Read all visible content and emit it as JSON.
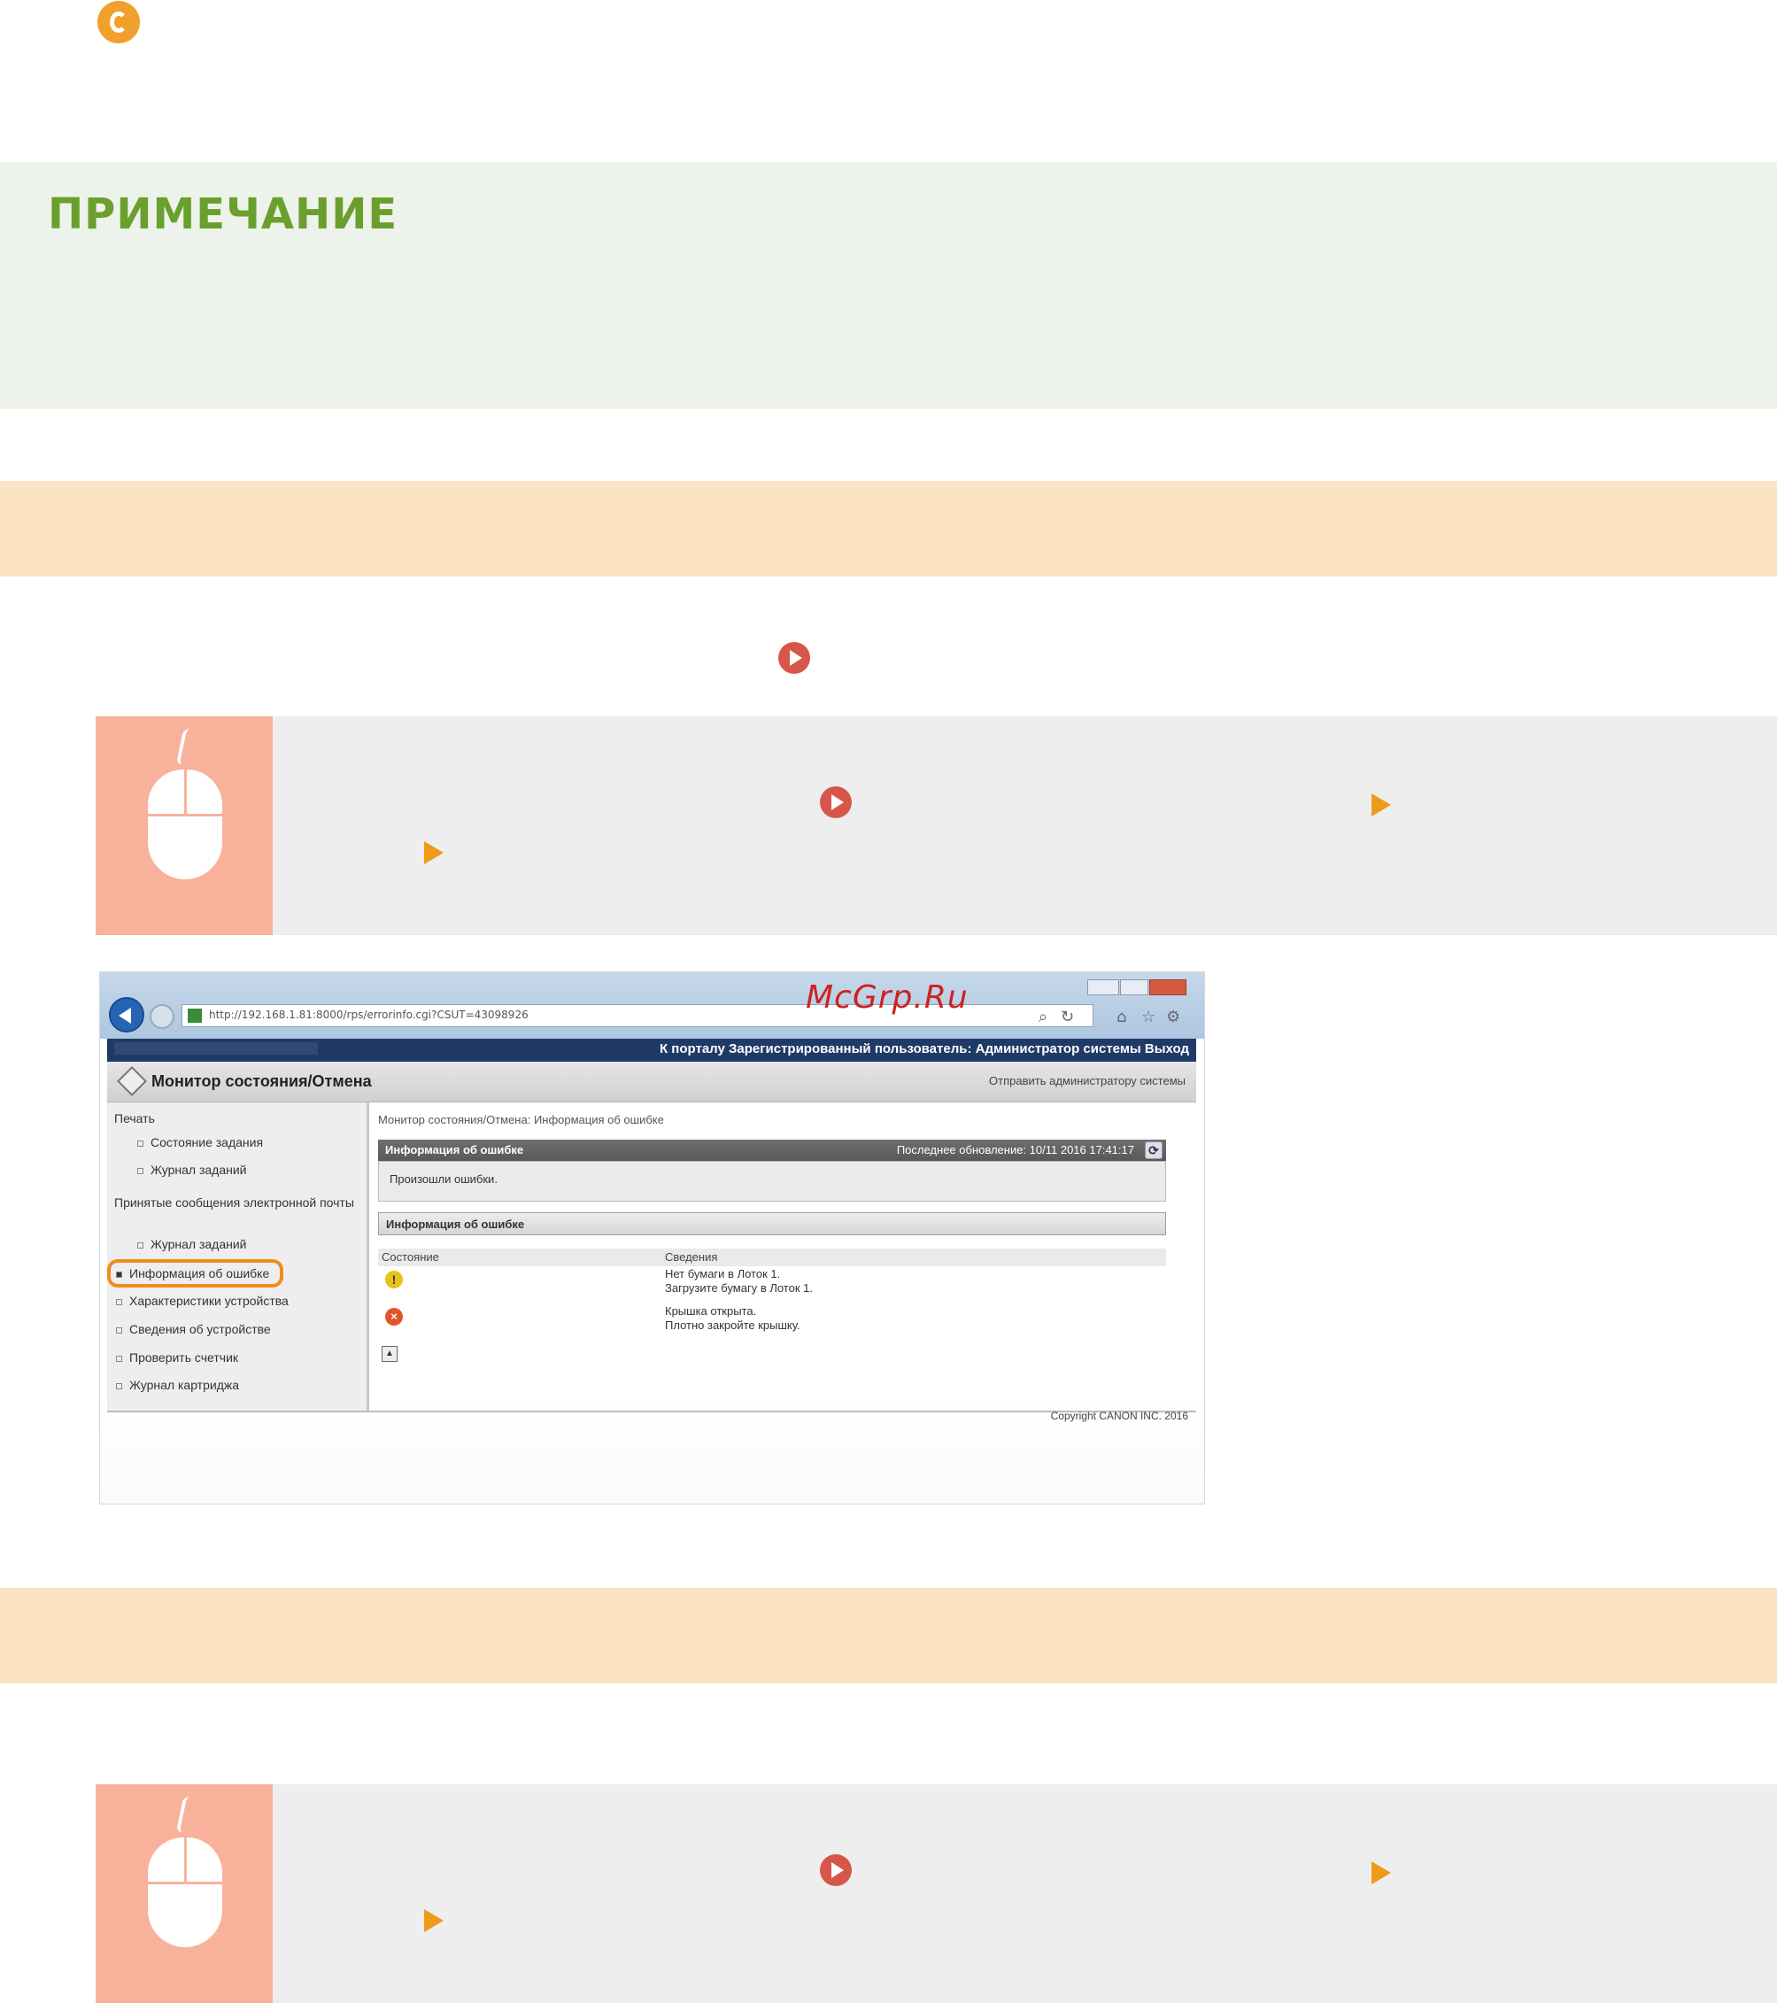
{
  "note": {
    "title": "ПРИМЕЧАНИЕ"
  },
  "watermark": "McGrp.Ru",
  "browser": {
    "address": "http://192.168.1.81:8000/rps/errorinfo.cgi?CSUT=43098926",
    "toolbar_icons": [
      "search-icon",
      "refresh-icon",
      "home-icon",
      "star-icon",
      "gear-icon"
    ],
    "navbar_links": "К порталу  Зарегистрированный пользователь: Администратор системы  Выход",
    "page_title": "Монитор состояния/Отмена",
    "send_admin": "Отправить администратору системы"
  },
  "sidebar": {
    "section_print": "Печать",
    "job_status": "Состояние задания",
    "job_log": "Журнал заданий",
    "section_email": "Принятые сообщения электронной почты",
    "email_job_log": "Журнал заданий",
    "items": [
      "Информация об ошибке",
      "Характеристики устройства",
      "Сведения об устройстве",
      "Проверить счетчик",
      "Журнал картриджа"
    ]
  },
  "main": {
    "breadcrumb": "Монитор состояния/Отмена: Информация об ошибке",
    "panel_title": "Информация об ошибке",
    "last_update": "Последнее обновление: 10/11 2016 17:41:17",
    "status_text": "Произошли ошибки.",
    "sub_title": "Информация об ошибке",
    "col_status": "Состояние",
    "col_details": "Сведения",
    "rows": [
      {
        "icon": "warning-icon",
        "line1": "Нет бумаги в Лоток 1.",
        "line2": "Загрузите бумагу в Лоток 1."
      },
      {
        "icon": "error-icon",
        "line1": "Крышка открыта.",
        "line2": "Плотно закройте крышку."
      }
    ],
    "copyright": "Copyright CANON INC. 2016"
  },
  "colors": {
    "note_bg": "#edf2ea",
    "note_title": "#6a9f2d",
    "band": "#fbe3c4",
    "mouse_panel": "#f8b29b",
    "step_bg": "#eeeeee",
    "highlight": "#f08d1b"
  }
}
